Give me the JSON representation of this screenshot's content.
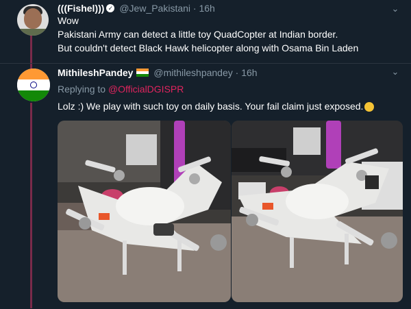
{
  "tweet1": {
    "display_name": "(((Fishel)))",
    "handle": "@Jew_Pakistani",
    "separator": "·",
    "time": "16h",
    "text_lines": [
      "Wow",
      "Pakistani Army can detect a little toy QuadCopter at Indian border.",
      "But couldn't detect Black Hawk helicopter along with Osama Bin Laden"
    ]
  },
  "tweet2": {
    "display_name": "MithileshPandey",
    "handle": "@mithileshpandey",
    "separator": "·",
    "time": "16h",
    "replying_prefix": "Replying to",
    "replying_mention": "@OfficialDGISPR",
    "text": "Lolz :) We play with such toy on daily basis. Your fail claim just exposed."
  },
  "icons": {
    "verified": "verified-badge-icon",
    "chevron": "chevron-down-icon",
    "flag": "india-flag-icon",
    "laugh": "rolling-on-floor-laughing-icon"
  },
  "colors": {
    "background": "#15202b",
    "muted": "#8899a6",
    "mention": "#e0245e",
    "thread_line": "#7a2a4a"
  }
}
